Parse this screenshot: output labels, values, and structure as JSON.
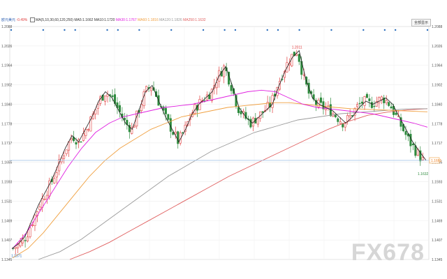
{
  "header": {
    "symbol": "欧元美元",
    "change": "-0.49%",
    "ma_label": "MA(5,10,30,60,120,250)",
    "ma_values": [
      {
        "name": "MA5",
        "value": "1.1662",
        "color": "#333333"
      },
      {
        "name": "MA10",
        "value": "1.1720",
        "color": "#333333"
      },
      {
        "name": "MA30",
        "value": "1.1767",
        "color": "#e020e0"
      },
      {
        "name": "MA60",
        "value": "1.1816",
        "color": "#f0a040"
      },
      {
        "name": "MA120",
        "value": "1.1826",
        "color": "#999999"
      },
      {
        "name": "MA250",
        "value": "1.1632",
        "color": "#e06060"
      }
    ],
    "button": "全部显示"
  },
  "watermark": "FX678",
  "colors": {
    "up": "#e03c3c",
    "down": "#2e8b3e",
    "ma5": "#333333",
    "ma10": "#1a1a1a",
    "ma30": "#e020e0",
    "ma60": "#f0a040",
    "ma120": "#9a9a9a",
    "ma250": "#e06060",
    "event_dot": "#2a6ebd",
    "price_line": "#a8c8e8"
  },
  "chart_data": {
    "type": "candlestick",
    "title": "",
    "y_ticks": [
      "1.2088",
      "1.2026",
      "1.1964",
      "1.1902",
      "1.1840",
      "1.1778",
      "1.1717",
      "1.1655",
      "1.1593",
      "1.1531",
      "1.1469",
      "1.1407",
      "1.1345"
    ],
    "ylim": [
      1.1345,
      1.2088
    ],
    "current_price": "1.1661",
    "annotations": [
      {
        "label": "1.2011",
        "value": 1.2011,
        "position": "high"
      },
      {
        "label": "1.1371",
        "value": 1.1371,
        "position": "low"
      },
      {
        "label": "1.1632",
        "value": 1.1632,
        "position": "last-low"
      }
    ],
    "close_path": [
      1.138,
      1.1395,
      1.142,
      1.147,
      1.152,
      1.156,
      1.16,
      1.165,
      1.17,
      1.174,
      1.172,
      1.176,
      1.18,
      1.185,
      1.188,
      1.186,
      1.182,
      1.178,
      1.176,
      1.182,
      1.188,
      1.19,
      1.185,
      1.18,
      1.176,
      1.172,
      1.176,
      1.181,
      1.184,
      1.186,
      1.188,
      1.193,
      1.196,
      1.19,
      1.183,
      1.18,
      1.178,
      1.18,
      1.182,
      1.184,
      1.19,
      1.195,
      1.199,
      1.2011,
      1.192,
      1.186,
      1.184,
      1.183,
      1.182,
      1.18,
      1.178,
      1.18,
      1.183,
      1.185,
      1.184,
      1.185,
      1.186,
      1.184,
      1.18,
      1.176,
      1.172,
      1.169,
      1.1661
    ],
    "ma_paths": {
      "ma30": [
        1.138,
        1.143,
        1.15,
        1.157,
        1.164,
        1.17,
        1.175,
        1.178,
        1.18,
        1.181,
        1.182,
        1.183,
        1.1835,
        1.184,
        1.185,
        1.186,
        1.187,
        1.188,
        1.1885,
        1.188,
        1.186,
        1.184,
        1.183,
        1.1825,
        1.182,
        1.1815,
        1.181,
        1.18,
        1.179,
        1.178,
        1.1767
      ],
      "ma60": [
        1.135,
        1.138,
        1.143,
        1.149,
        1.155,
        1.161,
        1.166,
        1.17,
        1.173,
        1.176,
        1.178,
        1.18,
        1.181,
        1.182,
        1.183,
        1.1835,
        1.184,
        1.1845,
        1.1845,
        1.184,
        1.1835,
        1.183,
        1.1826,
        1.1824,
        1.1822,
        1.182,
        1.1818,
        1.1816
      ],
      "ma120": [
        1.1345,
        1.137,
        1.141,
        1.146,
        1.151,
        1.156,
        1.161,
        1.165,
        1.169,
        1.172,
        1.175,
        1.177,
        1.179,
        1.18,
        1.181,
        1.1815,
        1.182,
        1.1825,
        1.1826
      ],
      "ma250": [
        1.1345,
        1.137,
        1.14,
        1.1435,
        1.147,
        1.1505,
        1.154,
        1.1575,
        1.161,
        1.164,
        1.167,
        1.17,
        1.173,
        1.176,
        1.1785,
        1.1805,
        1.1815,
        1.1822,
        1.1826
      ]
    },
    "grid": true,
    "legend": "top-left"
  }
}
